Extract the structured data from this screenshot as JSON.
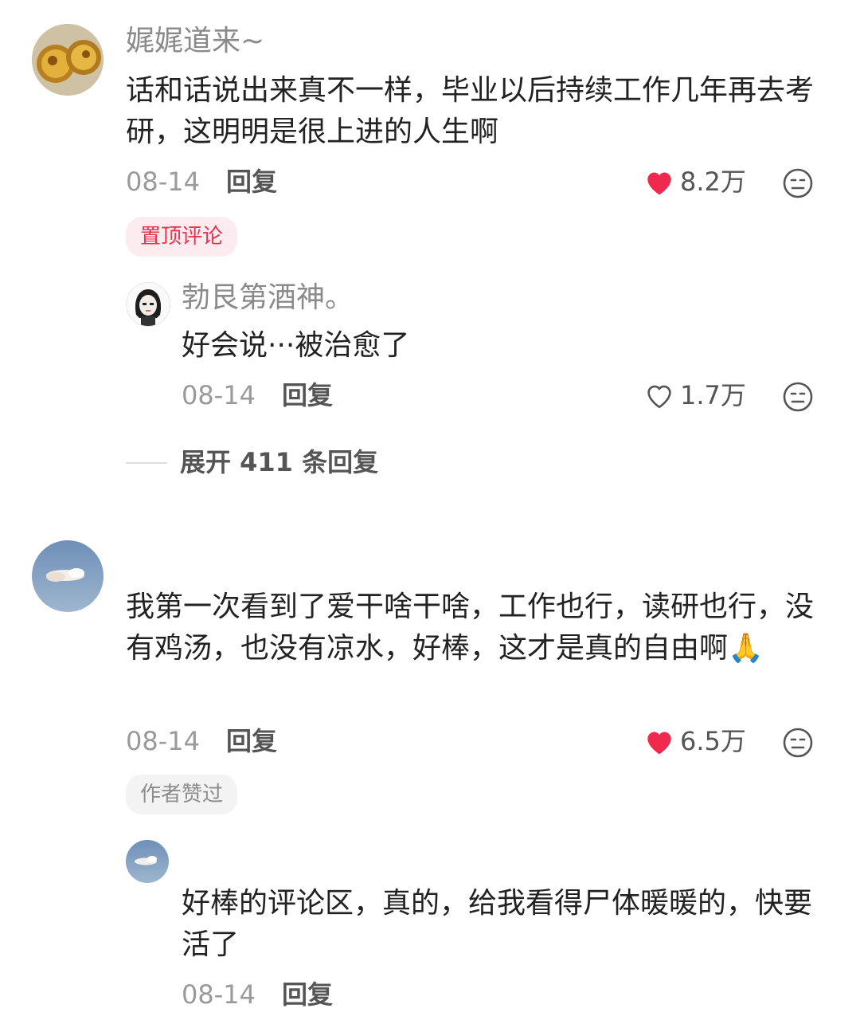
{
  "comments": [
    {
      "username": "娓娓道来~",
      "text": "话和话说出来真不一样，毕业以后持续工作几年再去考研，这明明是很上进的人生啊",
      "date": "08-14",
      "reply_label": "回复",
      "likes": "8.2万",
      "liked": true,
      "badge": "置顶评论",
      "replies": [
        {
          "username": "勃艮第酒神。",
          "text": "好会说···被治愈了",
          "date": "08-14",
          "reply_label": "回复",
          "likes": "1.7万",
          "liked": false
        }
      ],
      "expand_label": "展开 411 条回复"
    },
    {
      "text": "我第一次看到了爱干啥干啥，工作也行，读研也行，没有鸡汤，也没有凉水，好棒，这才是真的自由啊🙏",
      "date": "08-14",
      "reply_label": "回复",
      "likes": "6.5万",
      "liked": true,
      "badge": "作者赞过",
      "replies": [
        {
          "text": "好棒的评论区，真的，给我看得尸体暖暖的，快要活了",
          "date": "08-14",
          "reply_label": "回复"
        }
      ]
    }
  ],
  "colors": {
    "like_active": "#f0294e",
    "pinned_badge_text": "#e8334f",
    "pinned_badge_bg": "#fdecef",
    "author_badge_text": "#8c8c8c",
    "author_badge_bg": "#f3f3f3"
  }
}
